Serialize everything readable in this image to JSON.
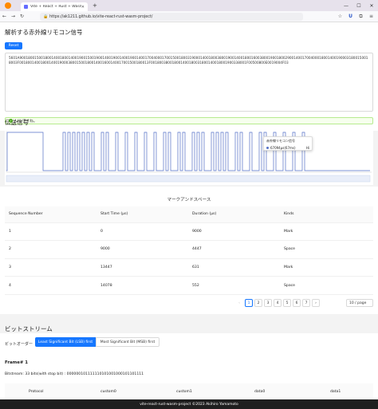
{
  "browser": {
    "tab_title": "Vite + React + Rust + Wasm",
    "url": "https://ak1211.github.io/vite-react-rust-wasm-project/"
  },
  "header": {
    "title": "解析する赤外線リモコン信号",
    "reset_label": "Reset"
  },
  "input": {
    "hex": "5601A900180015001800140018001400190015001900140019001400190014001700400017001500180031900014001800380019001400180016003800190018002900140017004000180014001900031800150018003F0018001400180014001900038001500180014001600140017001500180013F001800380018001400180031800140018001900338001F00500800E0019004F03"
  },
  "status": {
    "message": "いいですね。"
  },
  "signal": {
    "title": "伝送信号",
    "tooltip_title": "赤外線リモコン信号",
    "tooltip_value": "67094μs(67ms)",
    "tooltip_value2": "Hi"
  },
  "mark_space": {
    "title": "マークアンドスペース",
    "columns": [
      "Sequence Number",
      "Start Time (μs)",
      "Duration (μs)",
      "Kinds"
    ],
    "rows": [
      [
        "1",
        "0",
        "9000",
        "Mark"
      ],
      [
        "2",
        "9000",
        "4447",
        "Space"
      ],
      [
        "3",
        "13447",
        "631",
        "Mark"
      ],
      [
        "4",
        "14078",
        "552",
        "Space"
      ]
    ]
  },
  "pager": {
    "pages": [
      "1",
      "2",
      "3",
      "4",
      "5",
      "6",
      "7"
    ],
    "prev": "‹",
    "next": "›",
    "page_size": "10 / page"
  },
  "bitstream": {
    "title": "ビットストリーム",
    "bit_order_label": "ビットオーダー",
    "lsb_label": "Least Significant Bit (LSB) first",
    "msb_label": "Most Significant Bit (MSB) first",
    "frame_title": "Frame# 1",
    "bits_text": "Bitstream: 33 bits(with stop bit) : 000000101111110101001000101101111",
    "frame_columns": [
      "Protocol",
      "custom0",
      "custom1",
      "data0",
      "data1"
    ]
  },
  "footer": {
    "text": "vite-react-rust-wasm-project ©2023 Akihiro Yamamoto"
  },
  "colors": {
    "accent": "#1677ff",
    "signal": "#5470c6",
    "success": "#52c41a"
  }
}
